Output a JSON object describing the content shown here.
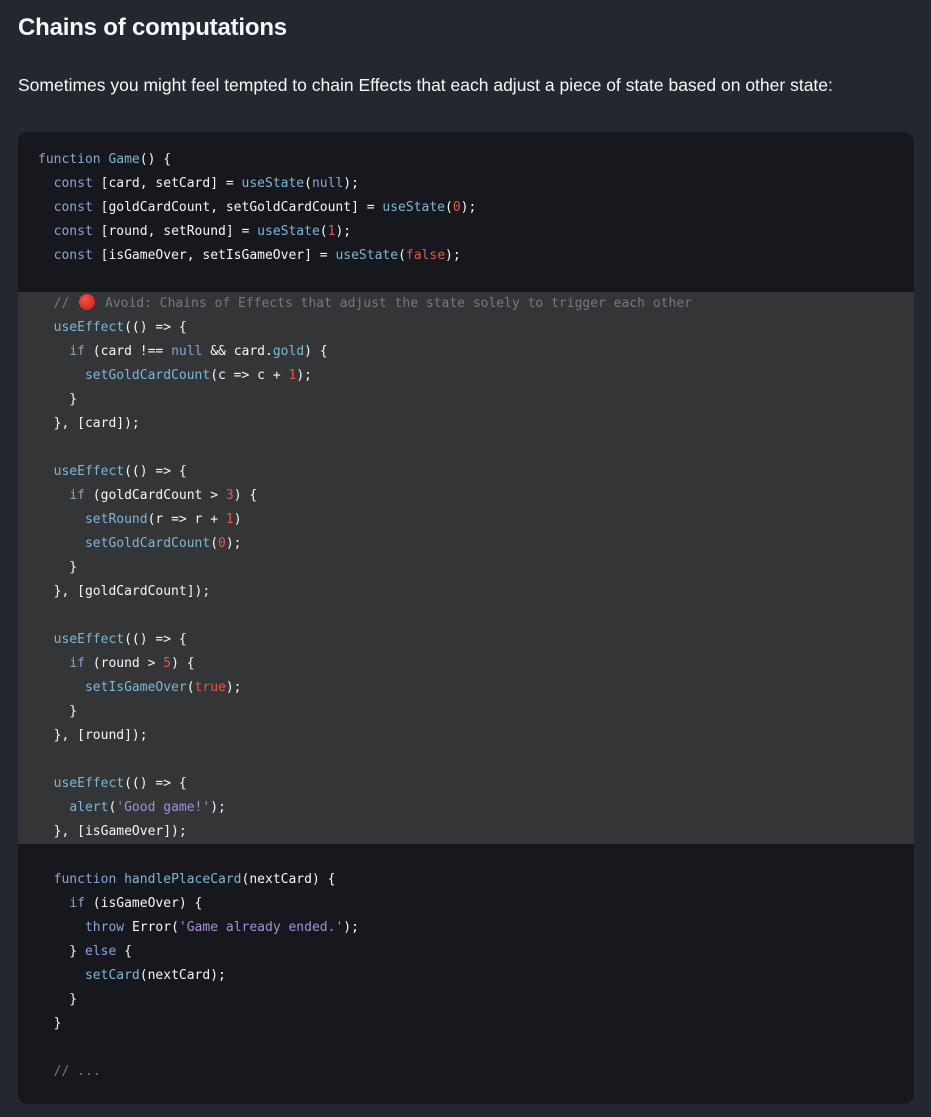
{
  "heading": "Chains of computations",
  "intro": "Sometimes you might feel tempted to chain Effects that each adjust a piece of state based on other state:",
  "code": {
    "highlight_icon": "red-circle-icon",
    "lines": [
      {
        "hl": false,
        "t": [
          [
            "kw",
            "function "
          ],
          [
            "fn",
            "Game"
          ],
          [
            "",
            "() {"
          ]
        ]
      },
      {
        "hl": false,
        "t": [
          [
            "",
            "  "
          ],
          [
            "kw",
            "const "
          ],
          [
            "",
            "[card, setCard] = "
          ],
          [
            "fn",
            "useState"
          ],
          [
            "",
            "("
          ],
          [
            "kw",
            "null"
          ],
          [
            "",
            ");"
          ]
        ]
      },
      {
        "hl": false,
        "t": [
          [
            "",
            "  "
          ],
          [
            "kw",
            "const "
          ],
          [
            "",
            "[goldCardCount, setGoldCardCount] = "
          ],
          [
            "fn",
            "useState"
          ],
          [
            "",
            "("
          ],
          [
            "num",
            "0"
          ],
          [
            "",
            ");"
          ]
        ]
      },
      {
        "hl": false,
        "t": [
          [
            "",
            "  "
          ],
          [
            "kw",
            "const "
          ],
          [
            "",
            "[round, setRound] = "
          ],
          [
            "fn",
            "useState"
          ],
          [
            "",
            "("
          ],
          [
            "num",
            "1"
          ],
          [
            "",
            ");"
          ]
        ]
      },
      {
        "hl": false,
        "t": [
          [
            "",
            "  "
          ],
          [
            "kw",
            "const "
          ],
          [
            "",
            "[isGameOver, setIsGameOver] = "
          ],
          [
            "fn",
            "useState"
          ],
          [
            "",
            "("
          ],
          [
            "num",
            "false"
          ],
          [
            "",
            ");"
          ]
        ]
      },
      {
        "hl": false,
        "t": [
          [
            "",
            ""
          ]
        ]
      },
      {
        "hl": true,
        "t": [
          [
            "",
            "  "
          ],
          [
            "cm",
            "// "
          ],
          [
            "icon",
            ""
          ],
          [
            "cm",
            " Avoid: Chains of Effects that adjust the state solely to trigger each other"
          ]
        ]
      },
      {
        "hl": true,
        "t": [
          [
            "",
            "  "
          ],
          [
            "fn",
            "useEffect"
          ],
          [
            "",
            "(() => {"
          ]
        ]
      },
      {
        "hl": true,
        "t": [
          [
            "",
            "    "
          ],
          [
            "kw",
            "if "
          ],
          [
            "",
            "(card !== "
          ],
          [
            "kw",
            "null"
          ],
          [
            "",
            " && card."
          ],
          [
            "prop",
            "gold"
          ],
          [
            "",
            ") {"
          ]
        ]
      },
      {
        "hl": true,
        "t": [
          [
            "",
            "      "
          ],
          [
            "fn",
            "setGoldCardCount"
          ],
          [
            "",
            "(c => c + "
          ],
          [
            "num",
            "1"
          ],
          [
            "",
            ");"
          ]
        ]
      },
      {
        "hl": true,
        "t": [
          [
            "",
            "    }"
          ]
        ]
      },
      {
        "hl": true,
        "t": [
          [
            "",
            "  }, [card]);"
          ]
        ]
      },
      {
        "hl": true,
        "t": [
          [
            "",
            ""
          ]
        ]
      },
      {
        "hl": true,
        "t": [
          [
            "",
            "  "
          ],
          [
            "fn",
            "useEffect"
          ],
          [
            "",
            "(() => {"
          ]
        ]
      },
      {
        "hl": true,
        "t": [
          [
            "",
            "    "
          ],
          [
            "kw",
            "if "
          ],
          [
            "",
            "(goldCardCount > "
          ],
          [
            "num",
            "3"
          ],
          [
            "",
            ") {"
          ]
        ]
      },
      {
        "hl": true,
        "t": [
          [
            "",
            "      "
          ],
          [
            "fn",
            "setRound"
          ],
          [
            "",
            "(r => r + "
          ],
          [
            "num",
            "1"
          ],
          [
            "",
            ")"
          ]
        ]
      },
      {
        "hl": true,
        "t": [
          [
            "",
            "      "
          ],
          [
            "fn",
            "setGoldCardCount"
          ],
          [
            "",
            "("
          ],
          [
            "num",
            "0"
          ],
          [
            "",
            ");"
          ]
        ]
      },
      {
        "hl": true,
        "t": [
          [
            "",
            "    }"
          ]
        ]
      },
      {
        "hl": true,
        "t": [
          [
            "",
            "  }, [goldCardCount]);"
          ]
        ]
      },
      {
        "hl": true,
        "t": [
          [
            "",
            ""
          ]
        ]
      },
      {
        "hl": true,
        "t": [
          [
            "",
            "  "
          ],
          [
            "fn",
            "useEffect"
          ],
          [
            "",
            "(() => {"
          ]
        ]
      },
      {
        "hl": true,
        "t": [
          [
            "",
            "    "
          ],
          [
            "kw",
            "if "
          ],
          [
            "",
            "(round > "
          ],
          [
            "num",
            "5"
          ],
          [
            "",
            ") {"
          ]
        ]
      },
      {
        "hl": true,
        "t": [
          [
            "",
            "      "
          ],
          [
            "fn",
            "setIsGameOver"
          ],
          [
            "",
            "("
          ],
          [
            "num",
            "true"
          ],
          [
            "",
            ");"
          ]
        ]
      },
      {
        "hl": true,
        "t": [
          [
            "",
            "    }"
          ]
        ]
      },
      {
        "hl": true,
        "t": [
          [
            "",
            "  }, [round]);"
          ]
        ]
      },
      {
        "hl": true,
        "t": [
          [
            "",
            ""
          ]
        ]
      },
      {
        "hl": true,
        "t": [
          [
            "",
            "  "
          ],
          [
            "fn",
            "useEffect"
          ],
          [
            "",
            "(() => {"
          ]
        ]
      },
      {
        "hl": true,
        "t": [
          [
            "",
            "    "
          ],
          [
            "fn",
            "alert"
          ],
          [
            "",
            "("
          ],
          [
            "str",
            "'Good game!'"
          ],
          [
            "",
            ");"
          ]
        ]
      },
      {
        "hl": true,
        "t": [
          [
            "",
            "  }, [isGameOver]);"
          ]
        ]
      },
      {
        "hl": false,
        "t": [
          [
            "",
            ""
          ]
        ]
      },
      {
        "hl": false,
        "t": [
          [
            "",
            "  "
          ],
          [
            "kw",
            "function "
          ],
          [
            "fn",
            "handlePlaceCard"
          ],
          [
            "",
            "(nextCard) {"
          ]
        ]
      },
      {
        "hl": false,
        "t": [
          [
            "",
            "    "
          ],
          [
            "kw",
            "if "
          ],
          [
            "",
            "(isGameOver) {"
          ]
        ]
      },
      {
        "hl": false,
        "t": [
          [
            "",
            "      "
          ],
          [
            "kw",
            "throw "
          ],
          [
            "",
            "Error("
          ],
          [
            "str",
            "'Game already ended.'"
          ],
          [
            "",
            ");"
          ]
        ]
      },
      {
        "hl": false,
        "t": [
          [
            "",
            "    } "
          ],
          [
            "kw",
            "else "
          ],
          [
            "",
            "{"
          ]
        ]
      },
      {
        "hl": false,
        "t": [
          [
            "",
            "      "
          ],
          [
            "fn",
            "setCard"
          ],
          [
            "",
            "(nextCard);"
          ]
        ]
      },
      {
        "hl": false,
        "t": [
          [
            "",
            "    }"
          ]
        ]
      },
      {
        "hl": false,
        "t": [
          [
            "",
            "  }"
          ]
        ]
      },
      {
        "hl": false,
        "t": [
          [
            "",
            ""
          ]
        ]
      },
      {
        "hl": false,
        "t": [
          [
            "",
            "  "
          ],
          [
            "cm",
            "// ..."
          ]
        ]
      }
    ]
  }
}
